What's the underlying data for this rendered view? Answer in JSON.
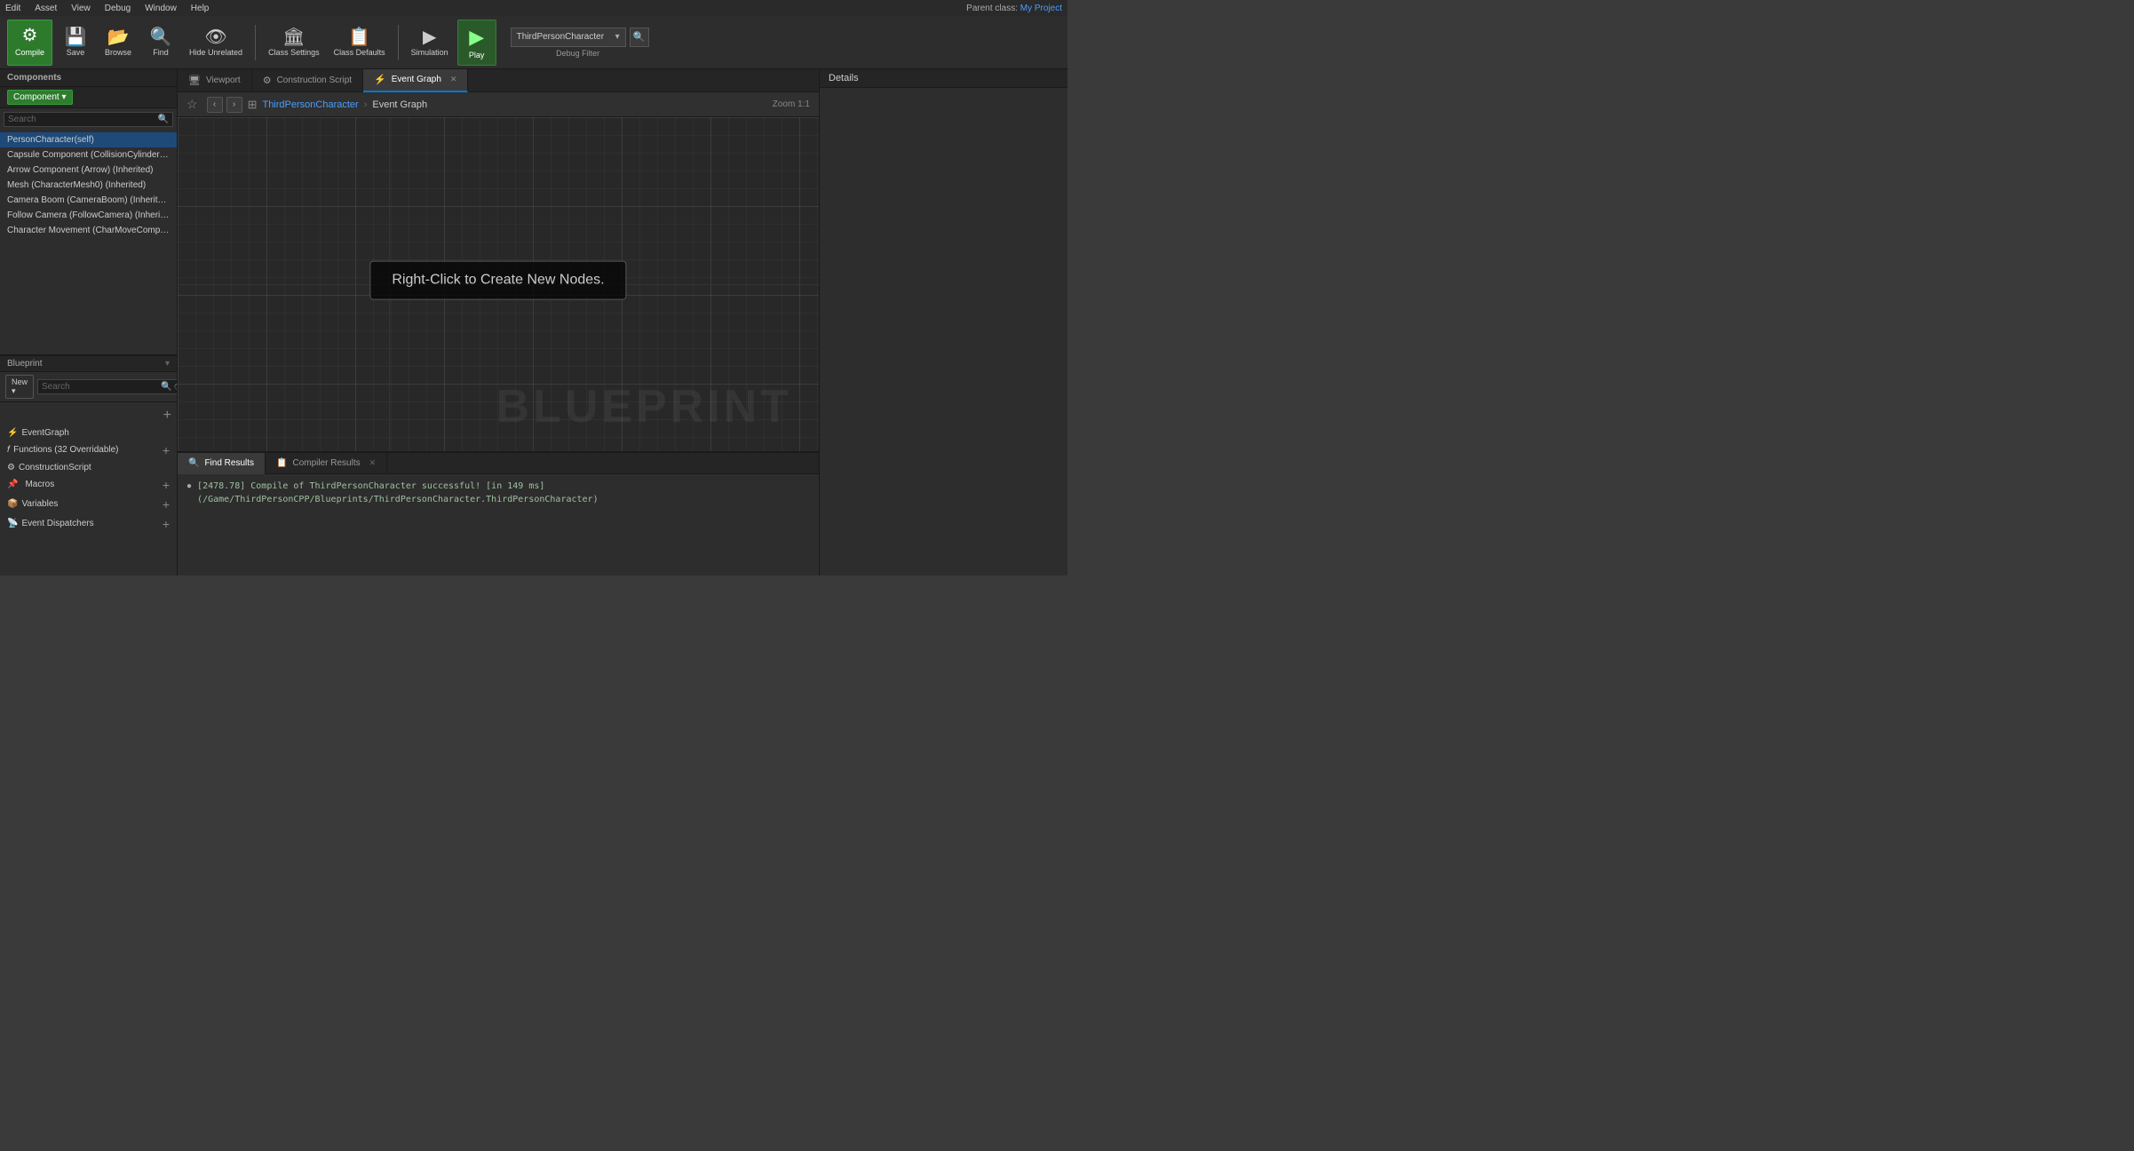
{
  "menu": {
    "items": [
      "Edit",
      "Asset",
      "View",
      "Debug",
      "Window",
      "Help"
    ],
    "parent_class_label": "Parent class:",
    "parent_class_value": "My Project"
  },
  "toolbar": {
    "compile_label": "Compile",
    "save_label": "Save",
    "browse_label": "Browse",
    "find_label": "Find",
    "hide_unrelated_label": "Hide Unrelated",
    "class_settings_label": "Class Settings",
    "class_defaults_label": "Class Defaults",
    "simulation_label": "Simulation",
    "play_label": "Play",
    "debug_filter_label": "Debug Filter",
    "debug_dropdown_value": "ThirdPersonCharacter"
  },
  "components_panel": {
    "header": "Components",
    "add_component_label": "Component ▾",
    "search_placeholder": "Search",
    "items": [
      "PersonCharacter(self)",
      "Capsule Component (CollisionCylinder) (Inher...",
      "Arrow Component (Arrow) (Inherited)",
      "Mesh (CharacterMesh0) (Inherited)",
      "Camera Boom (CameraBoom) (Inherited)",
      "Follow Camera (FollowCamera) (Inherited)",
      "Character Movement (CharMoveComp) (Inher..."
    ]
  },
  "blueprint_panel": {
    "header": "Blueprint",
    "new_btn_label": "New ▾",
    "search_placeholder": "Search",
    "tree_items": [
      {
        "label": "EventGraph",
        "add": false
      },
      {
        "label": "Functions (32 Overridable)",
        "add": true,
        "sub": true
      },
      {
        "label": "ConstructionScript",
        "add": false
      },
      {
        "label": "Macros",
        "add": true
      },
      {
        "label": "Variables",
        "add": true
      },
      {
        "label": "Event Dispatchers",
        "add": true
      }
    ]
  },
  "tabs": {
    "items": [
      {
        "label": "Viewport",
        "icon": "🖥"
      },
      {
        "label": "Construction Script",
        "icon": "⚙"
      },
      {
        "label": "Event Graph",
        "icon": "⚡",
        "active": true
      }
    ]
  },
  "breadcrumb": {
    "back_label": "‹",
    "forward_label": "›",
    "root": "ThirdPersonCharacter",
    "separator": "›",
    "current": "Event Graph",
    "zoom_label": "Zoom 1:1"
  },
  "graph": {
    "hint_text": "Right-Click to Create New Nodes.",
    "watermark": "BLUEPRINT"
  },
  "right_panel": {
    "header": "Details"
  },
  "bottom_panel": {
    "tabs": [
      {
        "label": "Find Results",
        "active": true,
        "icon": "🔍"
      },
      {
        "label": "Compiler Results",
        "active": false,
        "icon": "📋"
      }
    ],
    "log_items": [
      "[2478.78] Compile of ThirdPersonCharacter successful! [in 149 ms] (/Game/ThirdPersonCPP/Blueprints/ThirdPersonCharacter.ThirdPersonCharacter)"
    ]
  }
}
